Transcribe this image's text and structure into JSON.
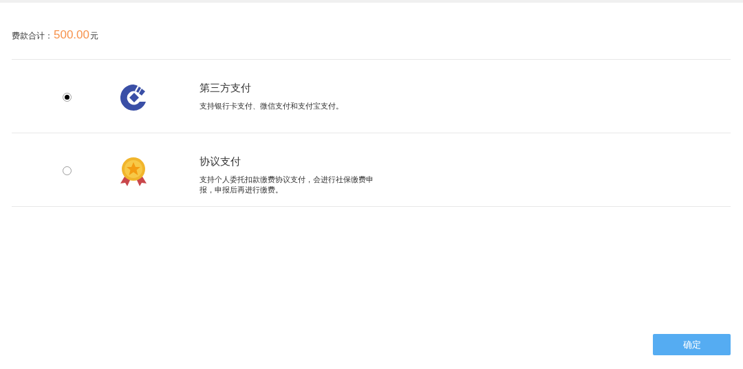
{
  "total": {
    "label": "费款合计：",
    "amount": "500.00",
    "unit": "元"
  },
  "options": [
    {
      "kind": "bank",
      "selected": true,
      "title": "第三方支付",
      "description": "支持银行卡支付、微信支付和支付宝支付。"
    },
    {
      "kind": "medal",
      "selected": false,
      "title": "协议支付",
      "description": "支持个人委托扣款缴费协议支付，会进行社保缴费申报，申报后再进行缴费。"
    }
  ],
  "confirm_button": "确定"
}
